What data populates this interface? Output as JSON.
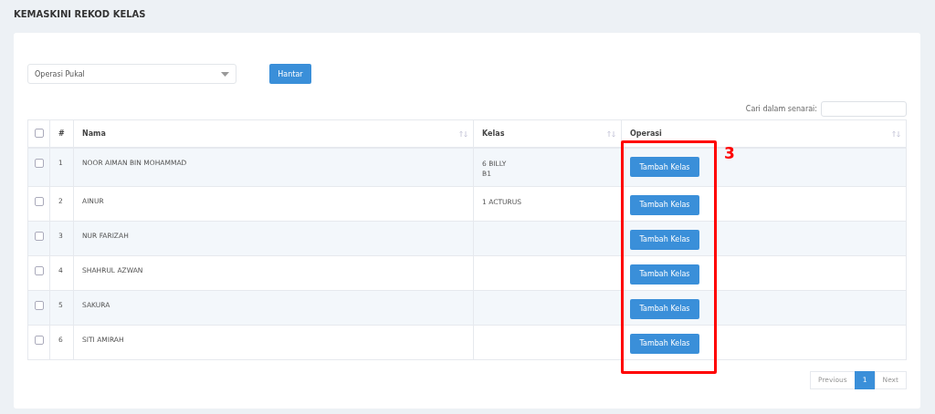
{
  "page_title": "KEMASKINI REKOD KELAS",
  "bulk_action": {
    "value": "Operasi Pukal",
    "submit": "Hantar"
  },
  "search": {
    "label": "Cari dalam senarai:"
  },
  "table": {
    "select_all": {
      "checked": false
    },
    "columns": [
      {
        "label": "#",
        "sortable": false
      },
      {
        "label": "Nama",
        "sortable": true
      },
      {
        "label": "Kelas",
        "sortable": true
      },
      {
        "label": "Operasi",
        "sortable": true
      }
    ],
    "rows": [
      {
        "checked": false,
        "no": "1",
        "name": "NOOR AIMAN BIN MOHAMMAD",
        "classes": [
          "6 BILLY",
          "B1"
        ],
        "action": "Tambah Kelas"
      },
      {
        "checked": false,
        "no": "2",
        "name": "AINUR",
        "classes": [
          "1 ACTURUS"
        ],
        "action": "Tambah Kelas"
      },
      {
        "checked": false,
        "no": "3",
        "name": "NUR FARIZAH",
        "classes": [],
        "action": "Tambah Kelas"
      },
      {
        "checked": false,
        "no": "4",
        "name": "SHAHRUL AZWAN",
        "classes": [],
        "action": "Tambah Kelas"
      },
      {
        "checked": false,
        "no": "5",
        "name": "SAKURA",
        "classes": [],
        "action": "Tambah Kelas"
      },
      {
        "checked": false,
        "no": "6",
        "name": "SITI AMIRAH",
        "classes": [],
        "action": "Tambah Kelas"
      }
    ]
  },
  "pagination": {
    "previous": "Previous",
    "pages": [
      {
        "label": "1",
        "selected": true
      }
    ],
    "next": "Next"
  },
  "annotation": {
    "label": "3"
  }
}
